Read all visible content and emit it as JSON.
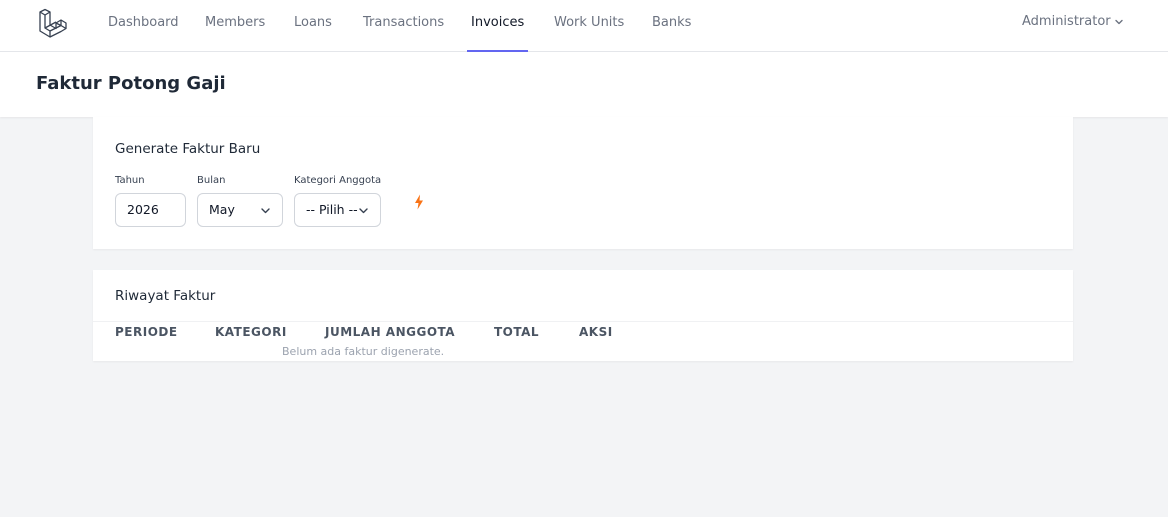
{
  "nav": {
    "items": [
      {
        "label": "Dashboard"
      },
      {
        "label": "Members"
      },
      {
        "label": "Loans"
      },
      {
        "label": "Transactions"
      },
      {
        "label": "Invoices",
        "active": true
      },
      {
        "label": "Work Units"
      },
      {
        "label": "Banks"
      }
    ],
    "user": "Administrator"
  },
  "page": {
    "title": "Faktur Potong Gaji"
  },
  "generate": {
    "title": "Generate Faktur Baru",
    "year": {
      "label": "Tahun",
      "value": "2026"
    },
    "month": {
      "label": "Bulan",
      "value": "May"
    },
    "category": {
      "label": "Kategori Anggota",
      "value": "-- Pilih --"
    },
    "submit_icon": "lightning-bolt-icon"
  },
  "history": {
    "title": "Riwayat Faktur",
    "columns": [
      "PERIODE",
      "KATEGORI",
      "JUMLAH ANGGOTA",
      "TOTAL",
      "AKSI"
    ],
    "empty_text": "Belum ada faktur digenerate."
  },
  "colors": {
    "accent": "#6366f1",
    "bolt": "#f97316",
    "background": "#f3f4f6"
  }
}
